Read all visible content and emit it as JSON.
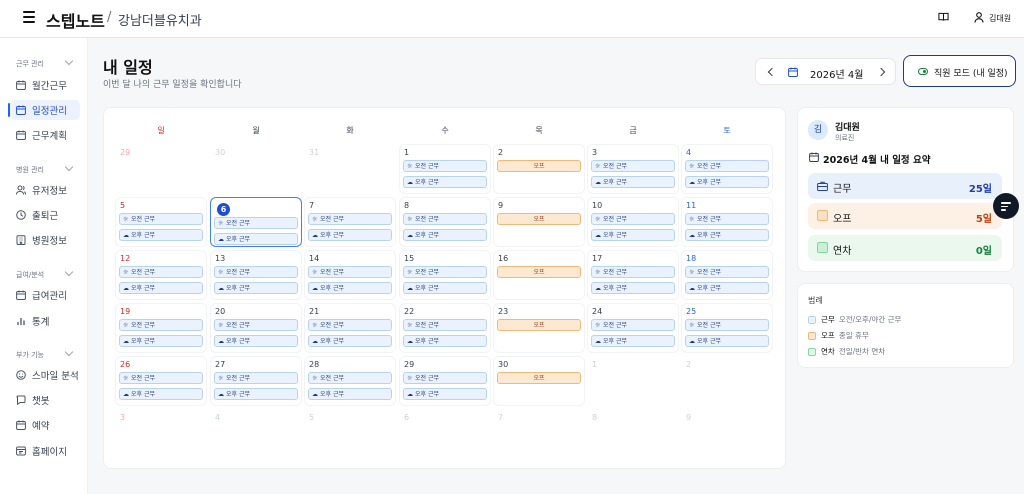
{
  "app": {
    "brand": "스텝노트",
    "separator": "/",
    "clinic": "강남더블유치과",
    "user": "김대원"
  },
  "sidebar": {
    "sections": [
      {
        "title": "근무 관리",
        "items": [
          "월간근무",
          "일정관리",
          "근무계획"
        ]
      },
      {
        "title": "병원 관리",
        "items": [
          "유저정보",
          "출퇴근",
          "병원정보"
        ]
      },
      {
        "title": "급여/분석",
        "items": [
          "급여관리",
          "통계"
        ]
      },
      {
        "title": "부가 기능",
        "items": [
          "스마일 분석",
          "챗봇",
          "예약",
          "홈페이지"
        ]
      }
    ]
  },
  "header": {
    "title": "내 일정",
    "subtitle": "이번 달 나의 근무 일정을 확인합니다",
    "month": "2026년 4월",
    "mode_button": "직원 모드 (내 일정)"
  },
  "calendar": {
    "weekdays": [
      "일",
      "월",
      "화",
      "수",
      "목",
      "금",
      "토"
    ],
    "labels": {
      "am": "오전 근무",
      "pm": "오후 근무",
      "off": "오프"
    },
    "days": [
      {
        "d": "29",
        "o": true,
        "t": ""
      },
      {
        "d": "30",
        "o": true,
        "t": ""
      },
      {
        "d": "31",
        "o": true,
        "t": ""
      },
      {
        "d": "1",
        "t": "w"
      },
      {
        "d": "2",
        "t": "off"
      },
      {
        "d": "3",
        "t": "w"
      },
      {
        "d": "4",
        "t": "w"
      },
      {
        "d": "5",
        "t": "w"
      },
      {
        "d": "6",
        "t": "w",
        "today": true
      },
      {
        "d": "7",
        "t": "w"
      },
      {
        "d": "8",
        "t": "w"
      },
      {
        "d": "9",
        "t": "off"
      },
      {
        "d": "10",
        "t": "w"
      },
      {
        "d": "11",
        "t": "w"
      },
      {
        "d": "12",
        "t": "w"
      },
      {
        "d": "13",
        "t": "w"
      },
      {
        "d": "14",
        "t": "w"
      },
      {
        "d": "15",
        "t": "w"
      },
      {
        "d": "16",
        "t": "off"
      },
      {
        "d": "17",
        "t": "w"
      },
      {
        "d": "18",
        "t": "w"
      },
      {
        "d": "19",
        "t": "w"
      },
      {
        "d": "20",
        "t": "w"
      },
      {
        "d": "21",
        "t": "w"
      },
      {
        "d": "22",
        "t": "w"
      },
      {
        "d": "23",
        "t": "off"
      },
      {
        "d": "24",
        "t": "w"
      },
      {
        "d": "25",
        "t": "w"
      },
      {
        "d": "26",
        "t": "w"
      },
      {
        "d": "27",
        "t": "w"
      },
      {
        "d": "28",
        "t": "w"
      },
      {
        "d": "29",
        "t": "w"
      },
      {
        "d": "30",
        "t": "off"
      },
      {
        "d": "1",
        "o": true,
        "t": ""
      },
      {
        "d": "2",
        "o": true,
        "t": ""
      },
      {
        "d": "3",
        "o": true,
        "t": ""
      },
      {
        "d": "4",
        "o": true,
        "t": ""
      },
      {
        "d": "5",
        "o": true,
        "t": ""
      },
      {
        "d": "6",
        "o": true,
        "t": ""
      },
      {
        "d": "7",
        "o": true,
        "t": ""
      },
      {
        "d": "8",
        "o": true,
        "t": ""
      },
      {
        "d": "9",
        "o": true,
        "t": ""
      }
    ]
  },
  "summary": {
    "avatar": "김",
    "name": "김대원",
    "role": "의료진",
    "title": "2026년 4월 내 일정 요약",
    "stats": [
      {
        "label": "근무",
        "value": "25일"
      },
      {
        "label": "오프",
        "value": "5일"
      },
      {
        "label": "연차",
        "value": "0일"
      }
    ]
  },
  "legend": {
    "title": "범례",
    "items": [
      {
        "label": "근무",
        "desc": "오전/오후/야간 근무",
        "color": "#eaf2fd"
      },
      {
        "label": "오프",
        "desc": "종일 휴무",
        "color": "#fde9d2"
      },
      {
        "label": "연차",
        "desc": "전일/반차 연차",
        "color": "#dcfce7"
      }
    ]
  },
  "colors": {
    "primary": "#1d4ed8",
    "work": "#eaf2fd",
    "off": "#fde9d2",
    "leave": "#dcfce7"
  }
}
